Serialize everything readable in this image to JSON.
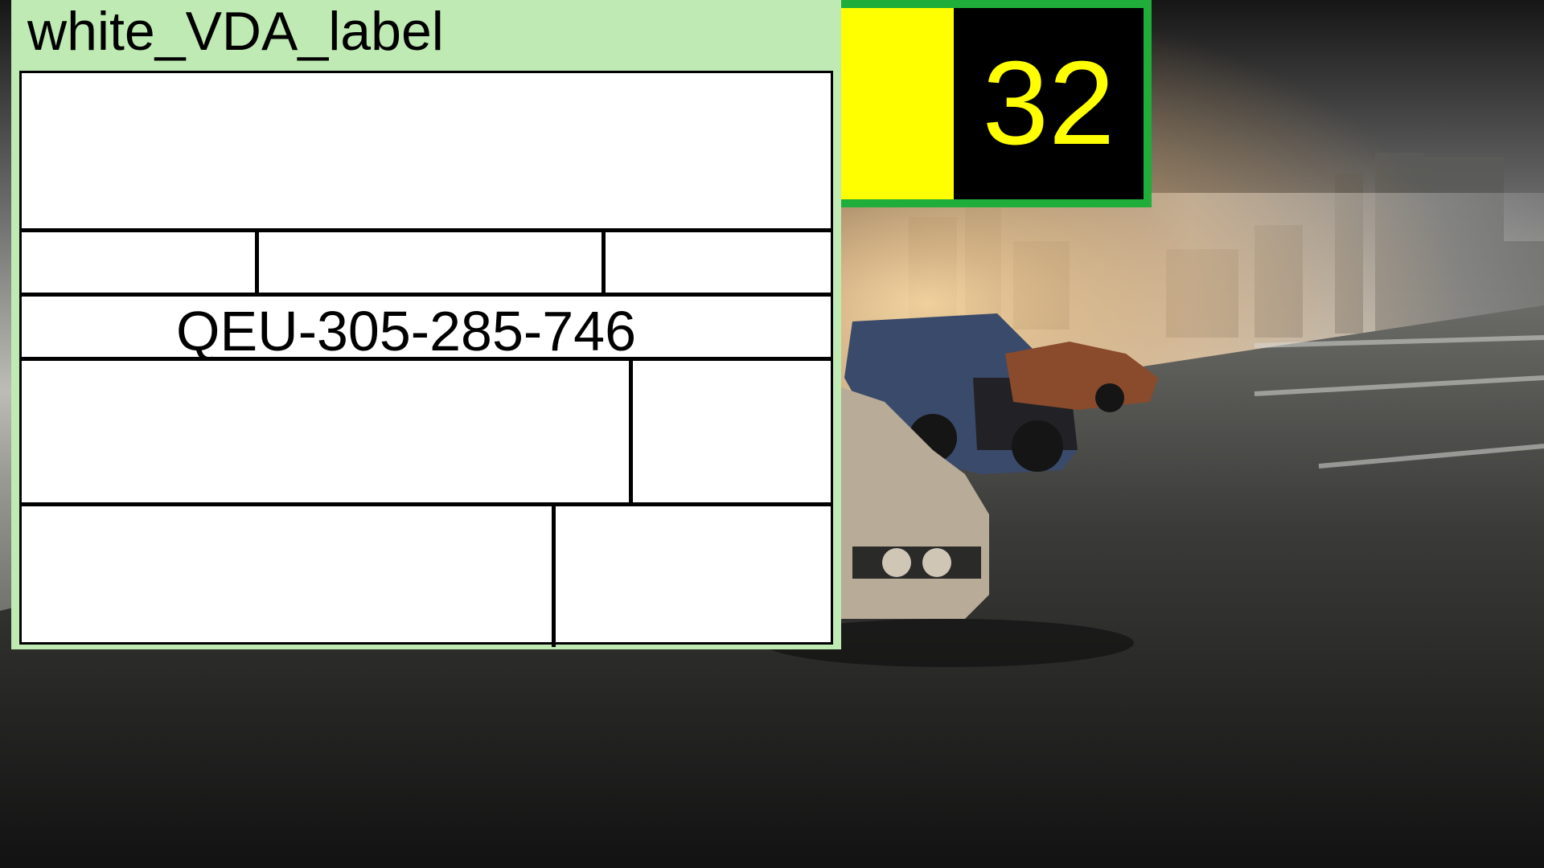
{
  "label": {
    "title": "white_VDA_label",
    "code": "QEU-305-285-746"
  },
  "counter": {
    "value": "32"
  },
  "colors": {
    "panel_bg": "#bfeab4",
    "counter_frame": "#1fae3a",
    "counter_yellow": "#ffff00",
    "counter_black": "#000000"
  }
}
